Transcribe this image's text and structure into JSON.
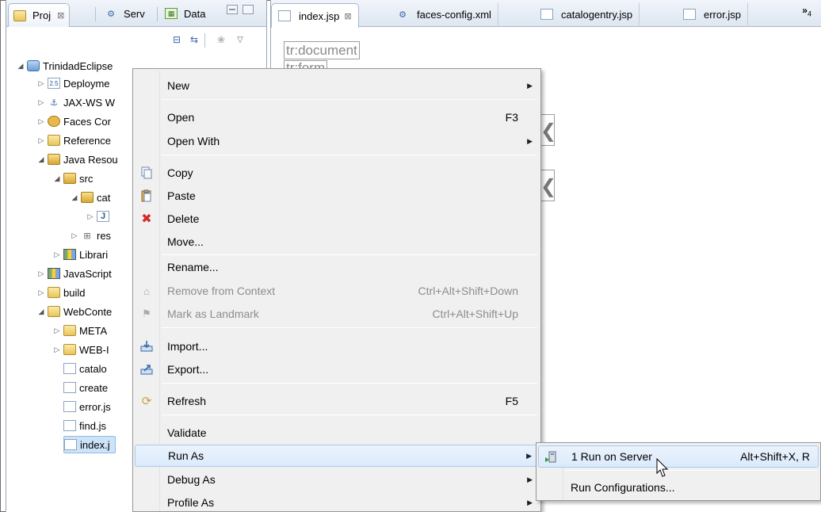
{
  "left_pane": {
    "tabs": [
      {
        "label": "Proj",
        "close": "⊠"
      },
      {
        "label": "Serv"
      },
      {
        "label": "Data"
      }
    ],
    "tree": [
      {
        "label": "TrinidadEclipse",
        "twisty": "◢",
        "icon": "proj"
      },
      {
        "label": "Deployme",
        "twisty": "▷",
        "icon": "file"
      },
      {
        "label": "JAX-WS W",
        "twisty": "▷",
        "icon": "ws"
      },
      {
        "label": "Faces Cor",
        "twisty": "▷",
        "icon": "gear"
      },
      {
        "label": "Reference",
        "twisty": "▷",
        "icon": "folder"
      },
      {
        "label": "Java Resou",
        "twisty": "◢",
        "icon": "pkg"
      },
      {
        "label": "src",
        "twisty": "◢",
        "icon": "pkg"
      },
      {
        "label": "cat",
        "twisty": "◢",
        "icon": "pkg"
      },
      {
        "label": "",
        "twisty": "▷",
        "icon": "file"
      },
      {
        "label": "res",
        "twisty": "▷",
        "icon": "pkg"
      },
      {
        "label": "Librari",
        "twisty": "▷",
        "icon": "lib"
      },
      {
        "label": "JavaScript",
        "twisty": "▷",
        "icon": "lib"
      },
      {
        "label": "build",
        "twisty": "▷",
        "icon": "folder"
      },
      {
        "label": "WebConte",
        "twisty": "◢",
        "icon": "folder"
      },
      {
        "label": "META",
        "twisty": "▷",
        "icon": "folder"
      },
      {
        "label": "WEB-I",
        "twisty": "▷",
        "icon": "folder"
      },
      {
        "label": "catalo",
        "twisty": "",
        "icon": "file"
      },
      {
        "label": "create",
        "twisty": "",
        "icon": "file"
      },
      {
        "label": "error.js",
        "twisty": "",
        "icon": "file"
      },
      {
        "label": "find.js",
        "twisty": "",
        "icon": "file"
      },
      {
        "label": "index.j",
        "twisty": "",
        "icon": "file"
      }
    ]
  },
  "editor": {
    "tabs": [
      {
        "label": "index.jsp",
        "close": "⊠"
      },
      {
        "label": "faces-config.xml"
      },
      {
        "label": "catalogentry.jsp"
      },
      {
        "label": "error.jsp"
      }
    ],
    "overflow_label": "»",
    "overflow_count": "4",
    "tag_document": "tr:document",
    "tag_form": "tr:form"
  },
  "context_menu": {
    "items": [
      {
        "label": "New",
        "submenu": true
      },
      {
        "label": "Open",
        "key": "F3"
      },
      {
        "label": "Open With",
        "submenu": true
      },
      {
        "label": "Copy",
        "icon": "copy"
      },
      {
        "label": "Paste",
        "icon": "paste"
      },
      {
        "label": "Delete",
        "icon": "delete"
      },
      {
        "label": "Move..."
      },
      {
        "label": "Rename..."
      },
      {
        "label": "Remove from Context",
        "key": "Ctrl+Alt+Shift+Down",
        "disabled": true
      },
      {
        "label": "Mark as Landmark",
        "key": "Ctrl+Alt+Shift+Up",
        "disabled": true
      },
      {
        "label": "Import...",
        "icon": "import"
      },
      {
        "label": "Export...",
        "icon": "export"
      },
      {
        "label": "Refresh",
        "key": "F5",
        "icon": "refresh"
      },
      {
        "label": "Validate"
      },
      {
        "label": "Run As",
        "submenu": true,
        "highlight": true
      },
      {
        "label": "Debug As",
        "submenu": true
      },
      {
        "label": "Profile As",
        "submenu": true
      }
    ]
  },
  "run_as_submenu": {
    "items": [
      {
        "label": "1 Run on Server",
        "key": "Alt+Shift+X, R",
        "highlight": true
      },
      {
        "label": "Run Configurations..."
      }
    ]
  },
  "colors": {
    "highlight_bg": "#dbeafc",
    "highlight_border": "#a8c9ee",
    "delete_red": "#d42a2a",
    "disabled_text": "#8d8d8d"
  }
}
